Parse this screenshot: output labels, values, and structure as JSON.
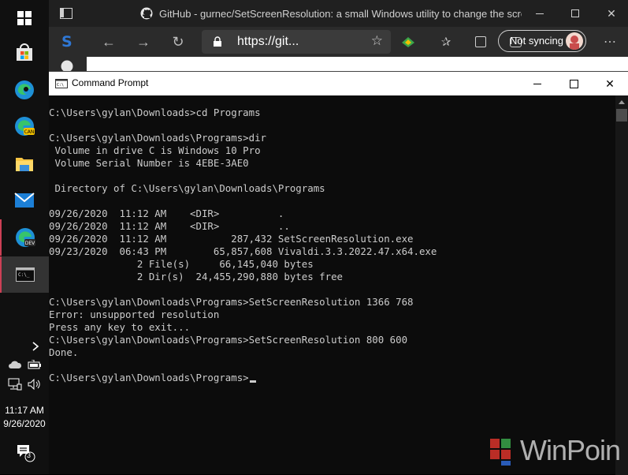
{
  "taskbar": {
    "clock_time": "11:17 AM",
    "clock_date": "9/26/2020",
    "notification_count": "3",
    "icons": [
      "windows-start-icon",
      "store-icon",
      "edge-icon",
      "edge-canary-icon",
      "file-explorer-icon",
      "mail-icon",
      "edge-dev-icon",
      "command-prompt-icon"
    ],
    "tray": [
      "chevron-up-icon",
      "onedrive-icon",
      "battery-icon",
      "network-icon",
      "volume-icon",
      "notification-icon"
    ]
  },
  "browser": {
    "tab_title": "GitHub - gurnec/SetScreenResolution: a small Windows utility to change the screen r...",
    "address": "https://git...",
    "sync_label": "Not syncing"
  },
  "cmd": {
    "title": "Command Prompt",
    "output": "C:\\Users\\gylan\\Downloads>cd Programs\n\nC:\\Users\\gylan\\Downloads\\Programs>dir\n Volume in drive C is Windows 10 Pro\n Volume Serial Number is 4EBE-3AE0\n\n Directory of C:\\Users\\gylan\\Downloads\\Programs\n\n09/26/2020  11:12 AM    <DIR>          .\n09/26/2020  11:12 AM    <DIR>          ..\n09/26/2020  11:12 AM           287,432 SetScreenResolution.exe\n09/23/2020  06:43 PM        65,857,608 Vivaldi.3.3.2022.47.x64.exe\n               2 File(s)     66,145,040 bytes\n               2 Dir(s)  24,455,290,880 bytes free\n\nC:\\Users\\gylan\\Downloads\\Programs>SetScreenResolution 1366 768\nError: unsupported resolution\nPress any key to exit...\nC:\\Users\\gylan\\Downloads\\Programs>SetScreenResolution 800 600\nDone.\n\nC:\\Users\\gylan\\Downloads\\Programs>"
  },
  "watermark": {
    "text": "WinPoin"
  },
  "colors": {
    "console_bg": "#0c0c0c",
    "console_text": "#cccccc",
    "taskbar_bg": "#101010",
    "running_indicator": "#cc3f55"
  }
}
